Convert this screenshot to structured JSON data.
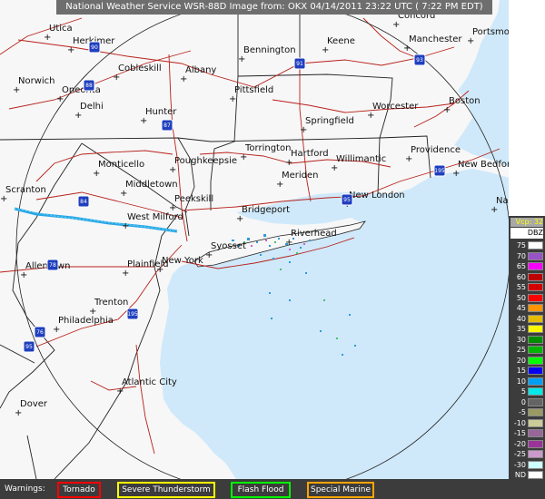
{
  "title": "National Weather Service WSR-88D Image from:  OKX 04/14/2011  23:22 UTC  ( 7:22 PM EDT)",
  "cities": [
    {
      "name": "Concord"
    },
    {
      "name": "Utica"
    },
    {
      "name": "Herkimer"
    },
    {
      "name": "Bennington"
    },
    {
      "name": "Keene"
    },
    {
      "name": "Manchester"
    },
    {
      "name": "Portsmouth"
    },
    {
      "name": "Norwich"
    },
    {
      "name": "Cobleskill"
    },
    {
      "name": "Albany"
    },
    {
      "name": "Oneonta"
    },
    {
      "name": "Pittsfield"
    },
    {
      "name": "Delhi"
    },
    {
      "name": "Hunter"
    },
    {
      "name": "Worcester"
    },
    {
      "name": "Springfield"
    },
    {
      "name": "Boston"
    },
    {
      "name": "Torrington"
    },
    {
      "name": "Hartford"
    },
    {
      "name": "Willimantic"
    },
    {
      "name": "Providence"
    },
    {
      "name": "Monticello"
    },
    {
      "name": "Poughkeepsie"
    },
    {
      "name": "New Bedford"
    },
    {
      "name": "Meriden"
    },
    {
      "name": "Middletown"
    },
    {
      "name": "Scranton"
    },
    {
      "name": "Peekskill"
    },
    {
      "name": "New London"
    },
    {
      "name": "Nantucket"
    },
    {
      "name": "Bridgeport"
    },
    {
      "name": "West Milford"
    },
    {
      "name": "Riverhead"
    },
    {
      "name": "Syosset"
    },
    {
      "name": "Allentown"
    },
    {
      "name": "Plainfield"
    },
    {
      "name": "New York"
    },
    {
      "name": "Trenton"
    },
    {
      "name": "Philadelphia"
    },
    {
      "name": "Atlantic City"
    },
    {
      "name": "Dover"
    }
  ],
  "highways": [
    {
      "number": "90"
    },
    {
      "number": "88"
    },
    {
      "number": "91"
    },
    {
      "number": "93"
    },
    {
      "number": "87"
    },
    {
      "number": "84"
    },
    {
      "number": "95"
    },
    {
      "number": "195"
    },
    {
      "number": "78"
    },
    {
      "number": "195"
    },
    {
      "number": "76"
    },
    {
      "number": "95"
    }
  ],
  "legend": {
    "vcp": "Vcp: 32",
    "unit": "DBZ",
    "rows": [
      {
        "label": "75",
        "color": "#ffffff"
      },
      {
        "label": "70",
        "color": "#9854c6"
      },
      {
        "label": "65",
        "color": "#f800fd"
      },
      {
        "label": "60",
        "color": "#bc0000"
      },
      {
        "label": "55",
        "color": "#d40000"
      },
      {
        "label": "50",
        "color": "#fd0000"
      },
      {
        "label": "45",
        "color": "#fd9500"
      },
      {
        "label": "40",
        "color": "#e5bc00"
      },
      {
        "label": "35",
        "color": "#fdf802"
      },
      {
        "label": "30",
        "color": "#008e00"
      },
      {
        "label": "25",
        "color": "#01b501"
      },
      {
        "label": "20",
        "color": "#02fd02"
      },
      {
        "label": "15",
        "color": "#0300f4"
      },
      {
        "label": "10",
        "color": "#019ff4"
      },
      {
        "label": "5",
        "color": "#04e9e7"
      },
      {
        "label": "0",
        "color": "#646464"
      },
      {
        "label": "-5",
        "color": "#999966"
      },
      {
        "label": "-10",
        "color": "#cccc99"
      },
      {
        "label": "-15",
        "color": "#996699"
      },
      {
        "label": "-20",
        "color": "#993399"
      },
      {
        "label": "-25",
        "color": "#cc99cc"
      },
      {
        "label": "-30",
        "color": "#ccffff"
      },
      {
        "label": "ND",
        "color": "#ffffff"
      }
    ]
  },
  "warnings": {
    "label": "Warnings:",
    "items": [
      {
        "label": "Tornado",
        "color": "#ff0000"
      },
      {
        "label": "Severe Thunderstorm",
        "color": "#ffff00"
      },
      {
        "label": "Flash Flood",
        "color": "#00ff00"
      },
      {
        "label": "Special Marine",
        "color": "#ffa500"
      }
    ]
  }
}
